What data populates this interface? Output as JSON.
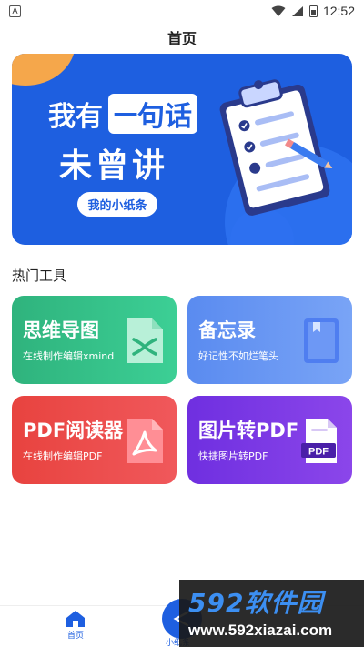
{
  "status_bar": {
    "app_badge": "A",
    "time": "12:52"
  },
  "header": {
    "title": "首页"
  },
  "banner": {
    "line1_a": "我有",
    "line1_box_a": "一",
    "line1_box_b": "句话",
    "line2": "未曾讲",
    "button": "我的小纸条"
  },
  "section": {
    "title": "热门工具"
  },
  "tools": [
    {
      "title": "思维导图",
      "subtitle": "在线制作编辑xmind",
      "icon": "xmind-file-icon",
      "color": "#32b883"
    },
    {
      "title": "备忘录",
      "subtitle": "好记性不如烂笔头",
      "icon": "notebook-icon",
      "color": "#6393f2"
    },
    {
      "title": "PDF阅读器",
      "subtitle": "在线制作编辑PDF",
      "icon": "pdf-file-icon",
      "color": "#ea4a48"
    },
    {
      "title": "图片转PDF",
      "subtitle": "快捷图片转PDF",
      "icon": "image-to-pdf-icon",
      "color": "#7b38e4"
    }
  ],
  "bottom_nav": {
    "home_label": "首页",
    "center_label": "小纸条"
  },
  "watermark": {
    "brand": "592软件园",
    "url": "www.592xiazai.com"
  }
}
